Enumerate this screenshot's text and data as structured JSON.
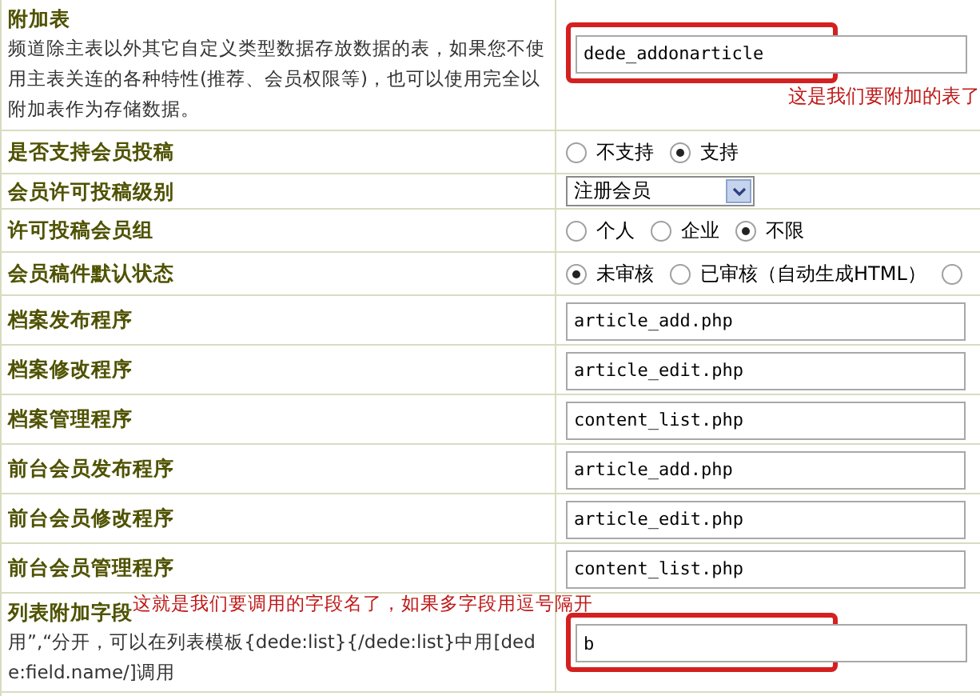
{
  "rows": [
    {
      "kind": "text",
      "label": "附加表",
      "description": "频道除主表以外其它自定义类型数据存放数据的表，如果您不使用主表关连的各种特性(推荐、会员权限等)，也可以使用完全以附加表作为存储数据。",
      "value": "dede_addonarticle",
      "highlighted": true,
      "note": "这是我们要附加的表了"
    },
    {
      "kind": "radio",
      "label": "是否支持会员投稿",
      "options": [
        {
          "label": "不支持",
          "selected": false
        },
        {
          "label": "支持",
          "selected": true
        }
      ]
    },
    {
      "kind": "select",
      "label": "会员许可投稿级别",
      "value": "注册会员"
    },
    {
      "kind": "radio",
      "label": "许可投稿会员组",
      "options": [
        {
          "label": "个人",
          "selected": false
        },
        {
          "label": "企业",
          "selected": false
        },
        {
          "label": "不限",
          "selected": true
        }
      ]
    },
    {
      "kind": "radio",
      "label": "会员稿件默认状态",
      "options": [
        {
          "label": "未审核",
          "selected": true
        },
        {
          "label": "已审核（自动生成HTML）",
          "selected": false
        },
        {
          "selected": false
        }
      ]
    },
    {
      "kind": "text",
      "label": "档案发布程序",
      "value": "article_add.php",
      "highlighted": false
    },
    {
      "kind": "text",
      "label": "档案修改程序",
      "value": "article_edit.php",
      "highlighted": false
    },
    {
      "kind": "text",
      "label": "档案管理程序",
      "value": "content_list.php",
      "highlighted": false
    },
    {
      "kind": "text",
      "label": "前台会员发布程序",
      "value": "article_add.php",
      "highlighted": false
    },
    {
      "kind": "text",
      "label": "前台会员修改程序",
      "value": "article_edit.php",
      "highlighted": false
    },
    {
      "kind": "text",
      "label": "前台会员管理程序",
      "value": "content_list.php",
      "highlighted": false
    },
    {
      "kind": "text",
      "label": "列表附加字段",
      "label_note": "这就是我们要调用的字段名了，如果多字段用逗号隔开",
      "description": "用”,“分开，可以在列表模板{dede:list}{/dede:list}中用[dede:field.name/]调用",
      "value": "b",
      "highlighted": true
    }
  ]
}
